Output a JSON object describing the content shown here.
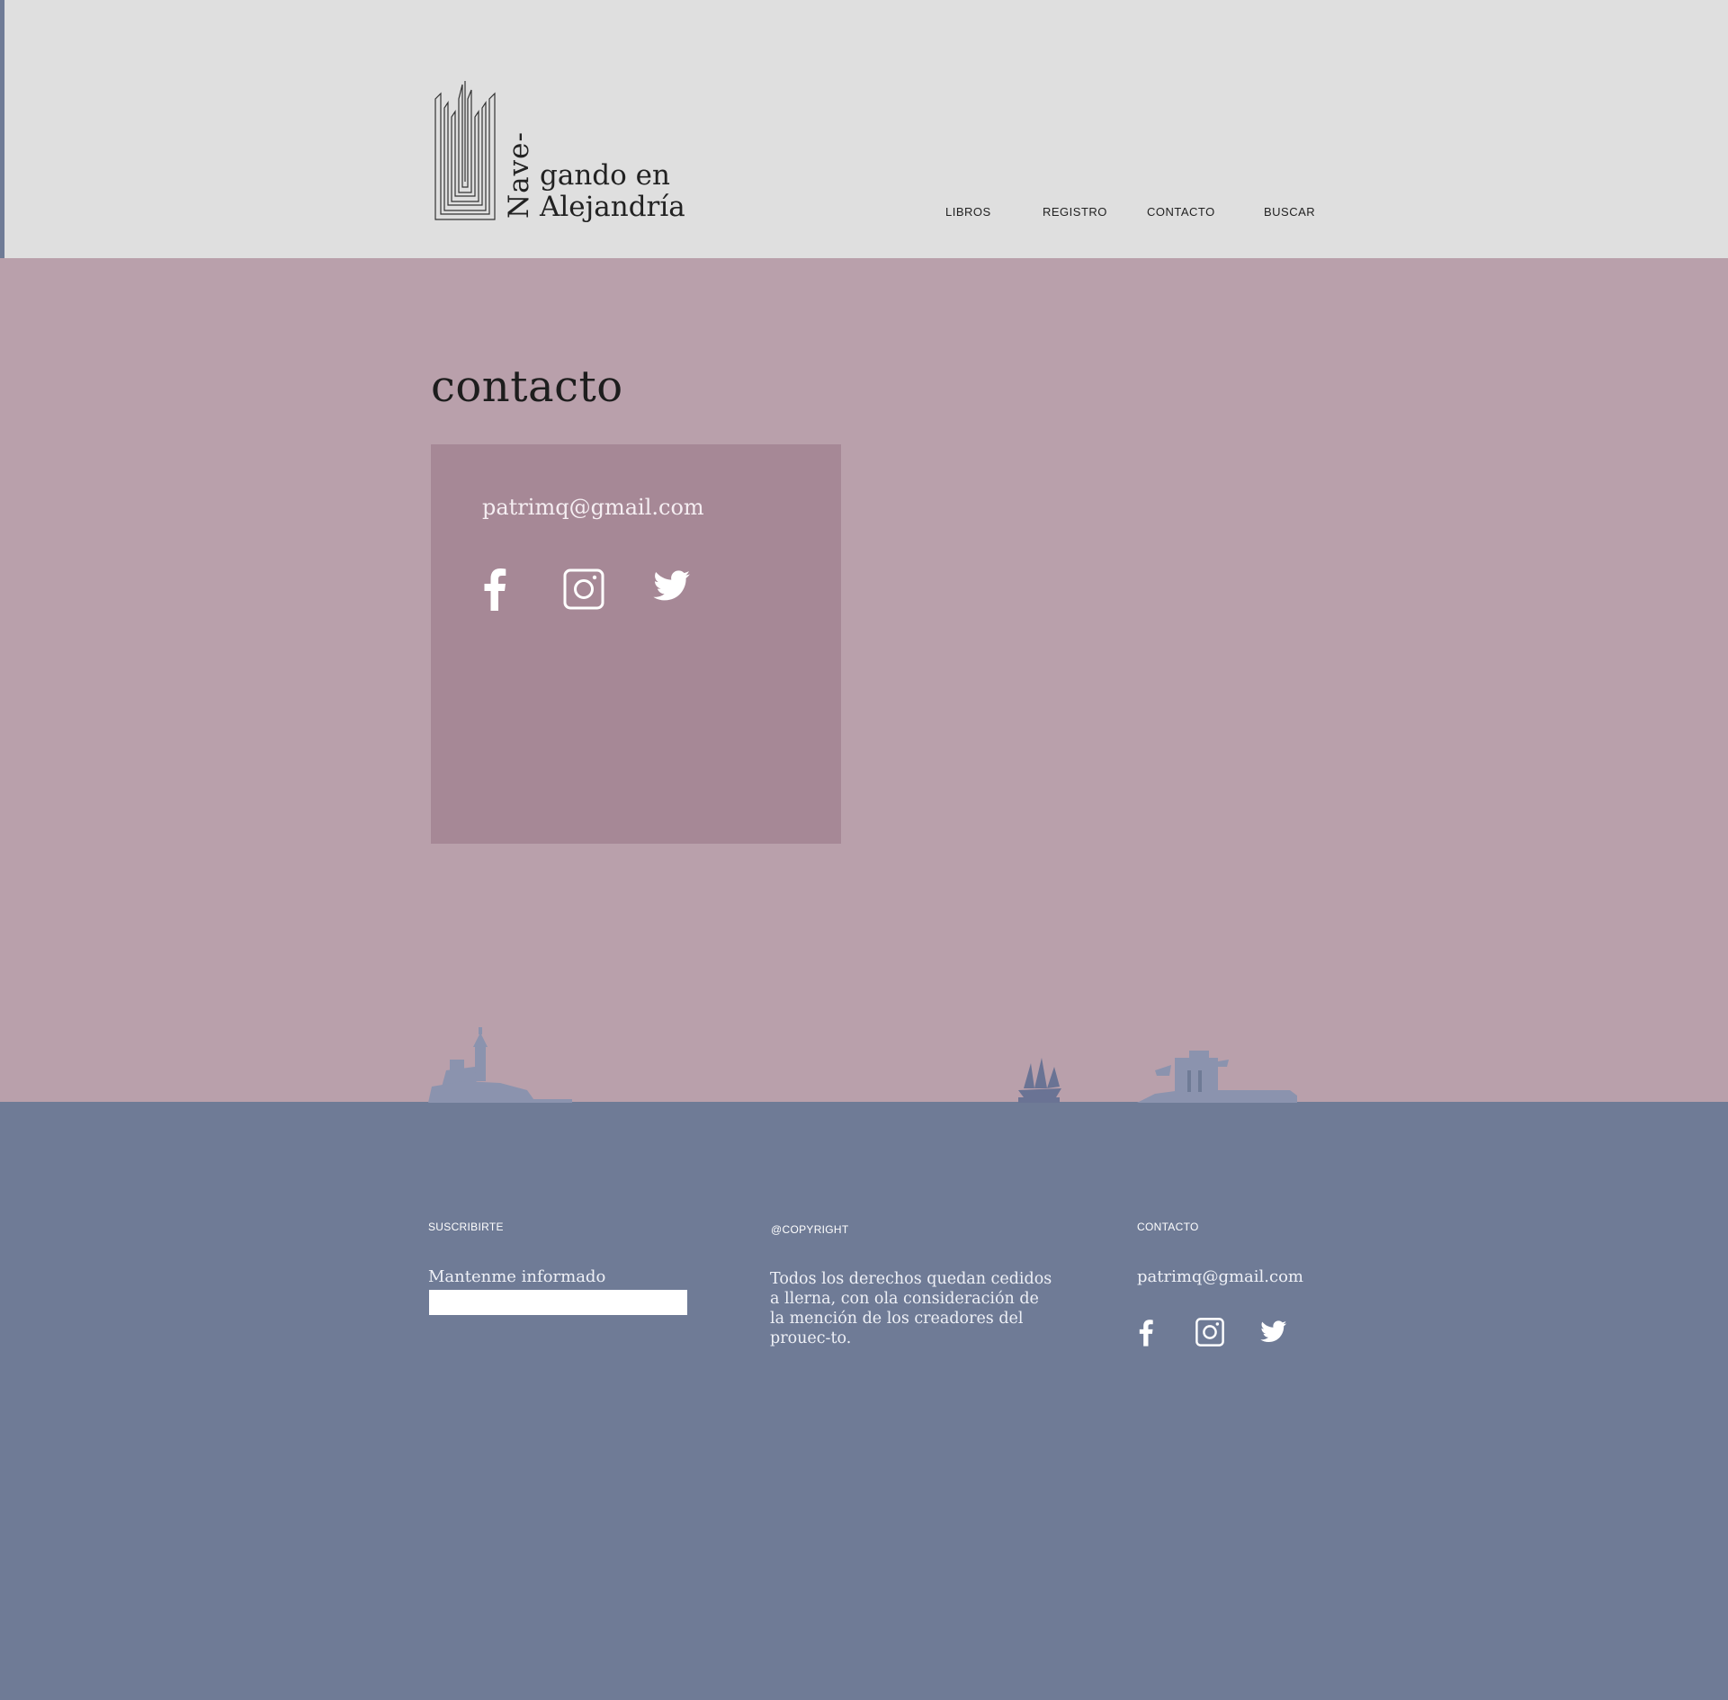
{
  "logo": {
    "vertical_text": "Nave-",
    "line1": "gando en",
    "line2": "Alejandría"
  },
  "nav": {
    "items": [
      {
        "label": "LIBROS"
      },
      {
        "label": "REGISTRO"
      },
      {
        "label": "CONTACTO"
      },
      {
        "label": "BUSCAR"
      }
    ]
  },
  "main": {
    "title": "contacto",
    "card": {
      "email": "patrimq@gmail.com",
      "social": [
        "facebook-icon",
        "instagram-icon",
        "twitter-icon"
      ]
    }
  },
  "footer": {
    "subscribe": {
      "title": "SUSCRIBIRTE",
      "label": "Mantenme informado",
      "input_value": ""
    },
    "copyright": {
      "title": "@COPYRIGHT",
      "text": "Todos los derechos quedan cedidos a llerna, con ola consideración de la mención de los creadores del prouec-to."
    },
    "contact": {
      "title": "CONTACTO",
      "email": "patrimq@gmail.com",
      "social": [
        "facebook-icon",
        "instagram-icon",
        "twitter-icon"
      ]
    }
  },
  "colors": {
    "header_bg": "#dfdfdf",
    "main_bg": "#b9a0ab",
    "card_bg": "#a68896",
    "footer_bg": "#6f7b96",
    "silhouette": "#8b93ae"
  }
}
